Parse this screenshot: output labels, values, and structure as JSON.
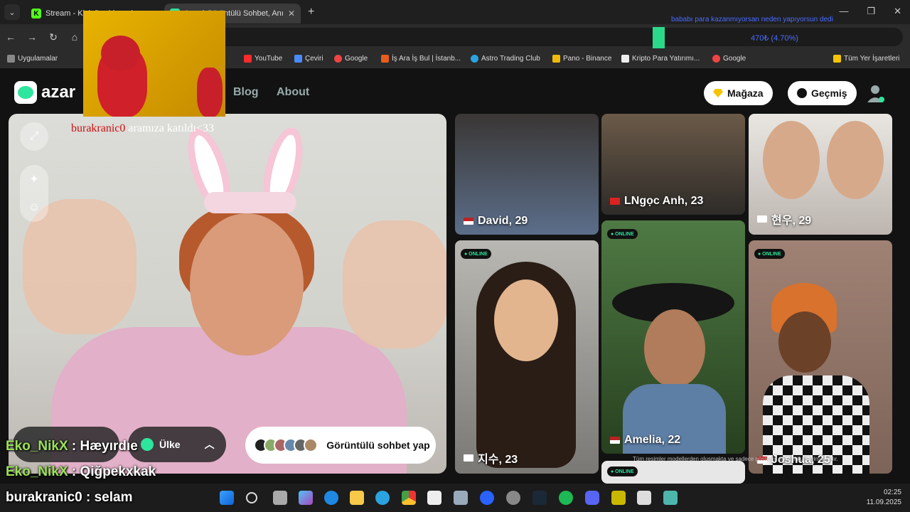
{
  "browser": {
    "tabs": [
      {
        "title": "Stream - Kick Dashboard"
      },
      {
        "title": "Azar | Görüntülü Sohbet, Anında"
      }
    ],
    "overlay_ticker": "bababı para kazanmıyorsan neden yapıyorsun dedi",
    "overlay_percent": "470₺ (4.70%)"
  },
  "bookmarks": [
    {
      "label": "Uygulamalar",
      "color": "#888"
    },
    {
      "label": "YouTube",
      "color": "#ff2b2b"
    },
    {
      "label": "Çeviri",
      "color": "#4a8cff"
    },
    {
      "label": "Google",
      "color": "#e44"
    },
    {
      "label": "İş Ara İş Bul | İstanb...",
      "color": "#e85d1b"
    },
    {
      "label": "Astro Trading Club",
      "color": "#2aa3e0"
    },
    {
      "label": "Pano - Binance",
      "color": "#f0b90b"
    },
    {
      "label": "Kripto Para Yatırımı...",
      "color": "#eee"
    },
    {
      "label": "Google",
      "color": "#e44"
    },
    {
      "label": "Tüm Yer İşaretleri",
      "color": "#f5c400"
    }
  ],
  "site": {
    "logo_text": "azar",
    "nav": [
      "Blog",
      "About"
    ],
    "shop_label": "Mağaza",
    "history_label": "Geçmiş"
  },
  "video": {
    "join_user": "burakranic0",
    "join_text": " aramıza katıldı<33",
    "country_label": "Ülke",
    "cta_label": "Görüntülü sohbet yap"
  },
  "profiles": [
    {
      "name": "David, 29",
      "online": false,
      "flag": "us"
    },
    {
      "name": "LNgọc Anh, 23",
      "online": false,
      "flag": "vn"
    },
    {
      "name": "현우, 29",
      "online": false,
      "flag": "kr"
    },
    {
      "name": "지수, 23",
      "online": true,
      "flag": "kr"
    },
    {
      "name": "Amelia, 22",
      "online": true,
      "flag": "us"
    },
    {
      "name": "Joshua, 25",
      "online": true,
      "flag": "us"
    }
  ],
  "online_label": "● ONLINE",
  "disclaimer": "Tüm resimler modellerden oluşmakta ve sadece gösterim amaçlı kullanılmaktadır.",
  "stream_chat": [
    {
      "user": "Eko_NikX",
      "text": " : Hæyırdıe"
    },
    {
      "user": "Eko_NikX",
      "text": " : Qiğpekxkak"
    },
    {
      "user": "burakranic0",
      "text": " : selam"
    }
  ],
  "taskbar": {
    "time": "02:25",
    "date": "11.09.2025"
  }
}
